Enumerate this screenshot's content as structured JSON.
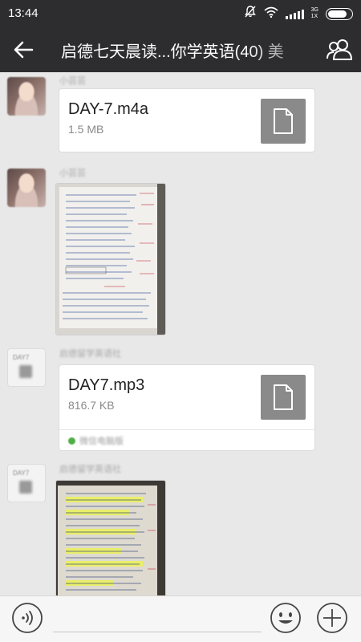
{
  "status": {
    "time": "13:44",
    "network": "3G",
    "network_sub": "1X"
  },
  "header": {
    "title": "启德七天晨读...你学英语(40) 美"
  },
  "messages": [
    {
      "sender": "小芸芸",
      "file": {
        "name": "DAY-7.m4a",
        "size": "1.5 MB"
      }
    },
    {
      "sender": "小芸芸"
    },
    {
      "sender": "启德留学英语社",
      "file": {
        "name": "DAY7.mp3",
        "size": "816.7 KB",
        "source": "微信电脑版"
      }
    },
    {
      "sender": "启德留学英语社"
    }
  ],
  "icons": {
    "back": "arrow-left-icon",
    "members": "group-members-icon",
    "voice": "voice-icon",
    "emoji": "emoji-icon",
    "more": "plus-icon",
    "file": "document-icon",
    "mute": "bell-off-icon",
    "wifi": "wifi-icon",
    "signal": "signal-icon",
    "battery": "battery-icon"
  },
  "colors": {
    "bar": "#2d2d2f",
    "chat_bg": "#e8e8e8",
    "file_icon": "#8a8a8a",
    "source_dot": "#4fae46"
  }
}
